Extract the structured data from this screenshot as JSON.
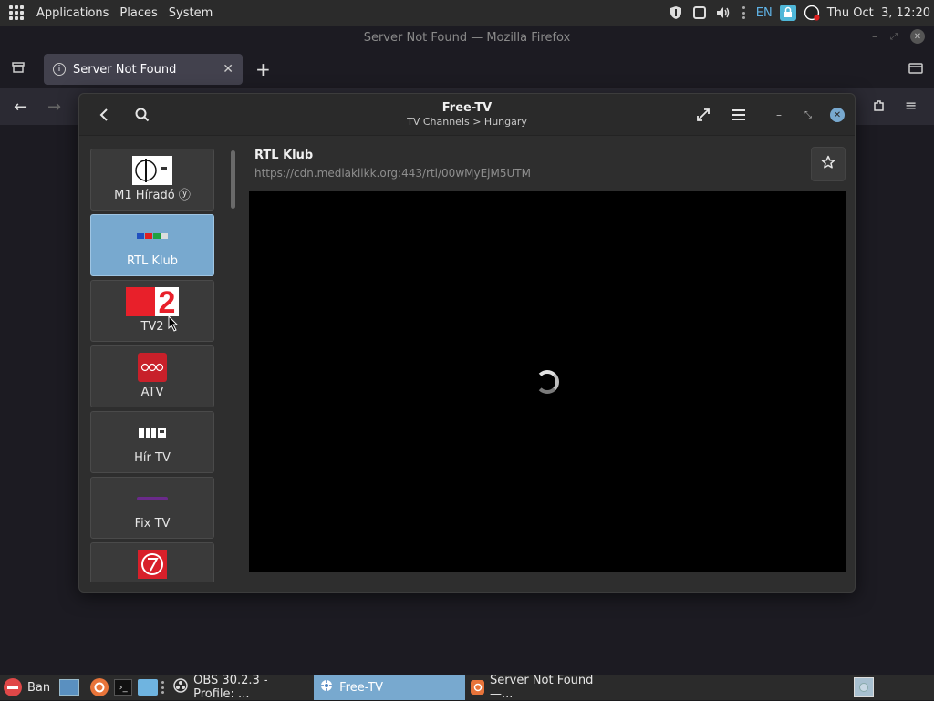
{
  "top_panel": {
    "menu": [
      "Applications",
      "Places",
      "System"
    ],
    "lang": "EN",
    "clock": "Thu Oct  3, 12:20"
  },
  "firefox": {
    "window_title": "Server Not Found — Mozilla Firefox",
    "tab_title": "Server Not Found"
  },
  "freetv": {
    "title": "Free-TV",
    "subtitle": "TV Channels > Hungary",
    "channels": [
      {
        "name": "M1 Híradó ⓨ",
        "selected": false
      },
      {
        "name": "RTL Klub",
        "selected": true
      },
      {
        "name": "TV2",
        "selected": false
      },
      {
        "name": "ATV",
        "selected": false
      },
      {
        "name": "Hír TV",
        "selected": false
      },
      {
        "name": "Fix TV",
        "selected": false
      },
      {
        "name": "",
        "selected": false
      }
    ],
    "current": {
      "title": "RTL Klub",
      "url": "https://cdn.mediaklikk.org:443/rtl/00wMyEjM5UTM"
    }
  },
  "taskbar": {
    "items": [
      {
        "label": "Ban",
        "active": false
      },
      {
        "label": "OBS 30.2.3 - Profile: ...",
        "active": false
      },
      {
        "label": "Free-TV",
        "active": true
      },
      {
        "label": "Server Not Found —...",
        "active": false
      }
    ]
  },
  "colors": {
    "accent": "#78a9cf",
    "tv2_red": "#e8202a",
    "atv_red": "#c8202a"
  }
}
